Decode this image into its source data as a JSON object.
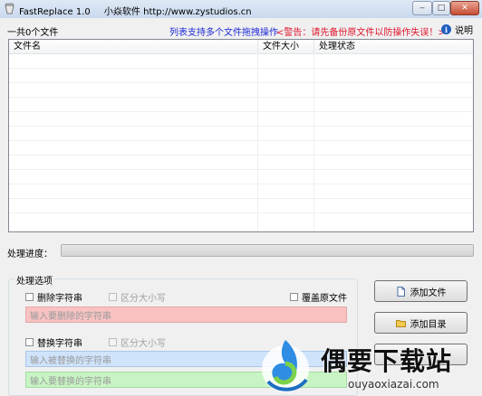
{
  "window": {
    "title": "FastReplace 1.0",
    "subtitle": "小焱软件 http://www.zystudios.cn",
    "buttons": {
      "minimize": "‒",
      "maximize": "□",
      "close": "✕"
    }
  },
  "header": {
    "file_count": "一共0个文件",
    "tip": "列表支持多个文件拖拽操作",
    "warning": "<警告：请先备份原文件以防操作失误！>",
    "help_label": "说明",
    "help_icon": "info-icon"
  },
  "file_list": {
    "columns": [
      "文件名",
      "文件大小",
      "处理状态"
    ],
    "rows": []
  },
  "progress": {
    "label": "处理进度：",
    "value": 0
  },
  "options": {
    "group_title": "处理选项",
    "delete_string": {
      "label": "删除字符串",
      "checked": false
    },
    "case_sensitive_1": {
      "label": "区分大小写",
      "checked": false,
      "disabled": true
    },
    "overwrite": {
      "label": "覆盖原文件",
      "checked": false
    },
    "delete_input_placeholder": "输入要删除的字符串",
    "replace_string": {
      "label": "替换字符串",
      "checked": false
    },
    "case_sensitive_2": {
      "label": "区分大小写",
      "checked": false,
      "disabled": true
    },
    "replace_from_placeholder": "输入被替换的字符串",
    "replace_to_placeholder": "输入要替换的字符串"
  },
  "actions": {
    "add_file": "添加文件",
    "add_folder": "添加目录"
  },
  "watermark": {
    "name": "偶要下载站",
    "url": "ouyaoxiazai.com"
  },
  "colors": {
    "tip": "#1e2bd6",
    "warning": "#e0142b",
    "delete_field": "#f8c2c2",
    "replace_from_field": "#cfe3fb",
    "replace_to_field": "#c8f4c4"
  }
}
